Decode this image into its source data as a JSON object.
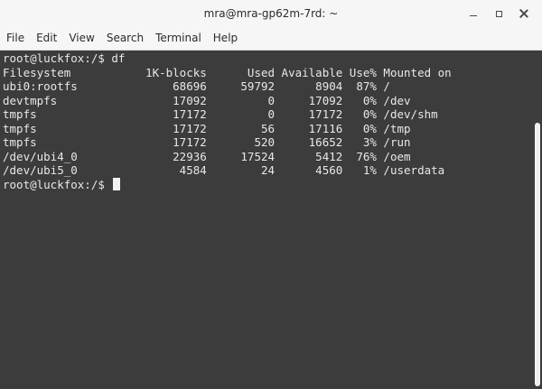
{
  "window": {
    "title": "mra@mra-gp62m-7rd: ~"
  },
  "menu": {
    "items": [
      {
        "label": "File",
        "name": "menu-file"
      },
      {
        "label": "Edit",
        "name": "menu-edit"
      },
      {
        "label": "View",
        "name": "menu-view"
      },
      {
        "label": "Search",
        "name": "menu-search"
      },
      {
        "label": "Terminal",
        "name": "menu-terminal"
      },
      {
        "label": "Help",
        "name": "menu-help"
      }
    ]
  },
  "terminal": {
    "lines": [
      "root@luckfox:/$ df",
      "Filesystem           1K-blocks      Used Available Use% Mounted on",
      "ubi0:rootfs              68696     59792      8904  87% /",
      "devtmpfs                 17092         0     17092   0% /dev",
      "tmpfs                    17172         0     17172   0% /dev/shm",
      "tmpfs                    17172        56     17116   0% /tmp",
      "tmpfs                    17172       520     16652   3% /run",
      "/dev/ubi4_0              22936     17524      5412  76% /oem",
      "/dev/ubi5_0               4584        24      4560   1% /userdata"
    ],
    "prompt": "root@luckfox:/$ "
  },
  "colors": {
    "terminal_bg": "#3c3c3c",
    "terminal_fg": "#e8e8e8",
    "chrome_bg": "#f6f6f6"
  }
}
